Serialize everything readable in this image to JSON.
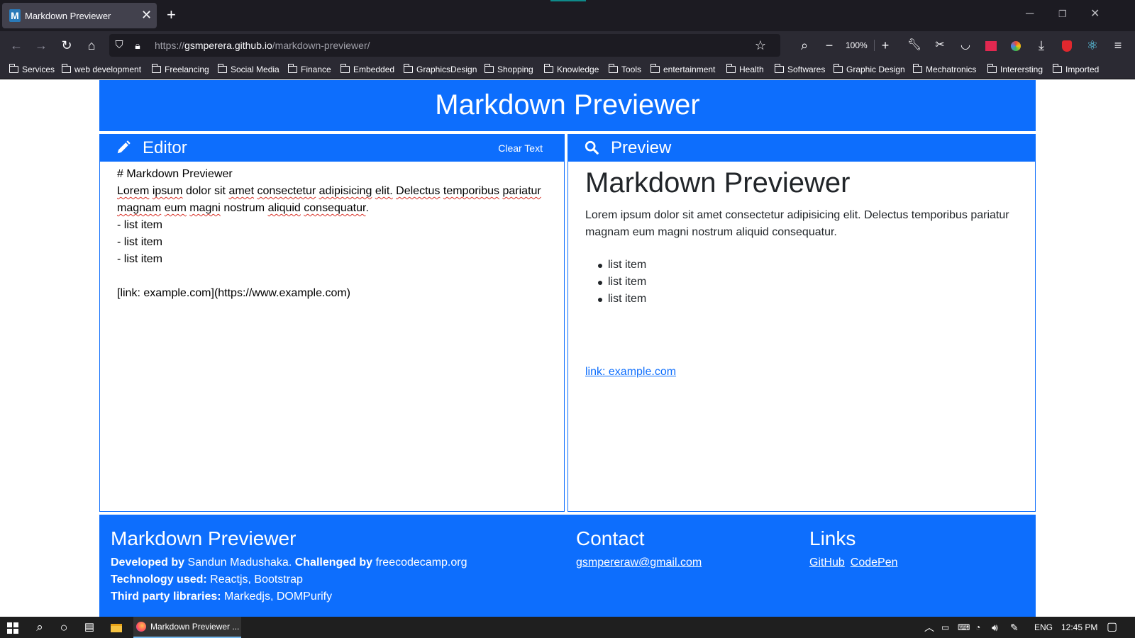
{
  "browser": {
    "tab_title": "Markdown Previewer",
    "tab_favicon": "M",
    "url_scheme": "https://",
    "url_domain": "gsmperera.github.io",
    "url_path": "/markdown-previewer/",
    "zoom": "100%",
    "bookmarks": [
      "Services",
      "web development",
      "Freelancing",
      "Social Media",
      "Finance",
      "Embedded",
      "GraphicsDesign",
      "Shopping",
      "Knowledge",
      "Tools",
      "entertainment",
      "Health",
      "Softwares",
      "Graphic Design",
      "Mechatronics",
      "Interersting",
      "Imported"
    ]
  },
  "page": {
    "header_title": "Markdown Previewer",
    "editor": {
      "title": "Editor",
      "clear_label": "Clear Text",
      "line1": "# Markdown Previewer",
      "p_words": [
        "Lorem",
        "ipsum",
        "dolor sit",
        "amet",
        "consectetur",
        "adipisicing",
        "elit.",
        "Delectus",
        "temporibus",
        "pariatur",
        "magnam",
        "eum",
        "magni",
        "nostrum",
        "aliquid",
        "consequatur",
        "."
      ],
      "list_lines": [
        "- list item",
        "- list item",
        "- list item"
      ],
      "link_line": "[link: example.com](https://www.example.com)"
    },
    "preview": {
      "title": "Preview",
      "h1": "Markdown Previewer",
      "paragraph": "Lorem ipsum dolor sit amet consectetur adipisicing elit. Delectus temporibus pariatur magnam eum magni nostrum aliquid consequatur.",
      "list": [
        "list item",
        "list item",
        "list item"
      ],
      "link_text": "link: example.com"
    },
    "footer": {
      "about_title": "Markdown Previewer",
      "developed_label": "Developed by",
      "developer": "Sandun Madushaka.",
      "challenged_label": "Challenged by",
      "challenger": "freecodecamp.org",
      "tech_label": "Technology used:",
      "tech": "Reactjs, Bootstrap",
      "libs_label": "Third party libraries:",
      "libs": "Markedjs, DOMPurify",
      "contact_title": "Contact",
      "email": "gsmpereraw@gmail.com",
      "links_title": "Links",
      "link_github": "GitHub",
      "link_codepen": "CodePen"
    }
  },
  "taskbar": {
    "app_label": "Markdown Previewer ...",
    "language": "ENG",
    "time": "12:45 PM"
  },
  "colors": {
    "accent": "#0d6efd",
    "chrome_dark": "#1c1b22",
    "toolbar": "#2b2a33"
  }
}
